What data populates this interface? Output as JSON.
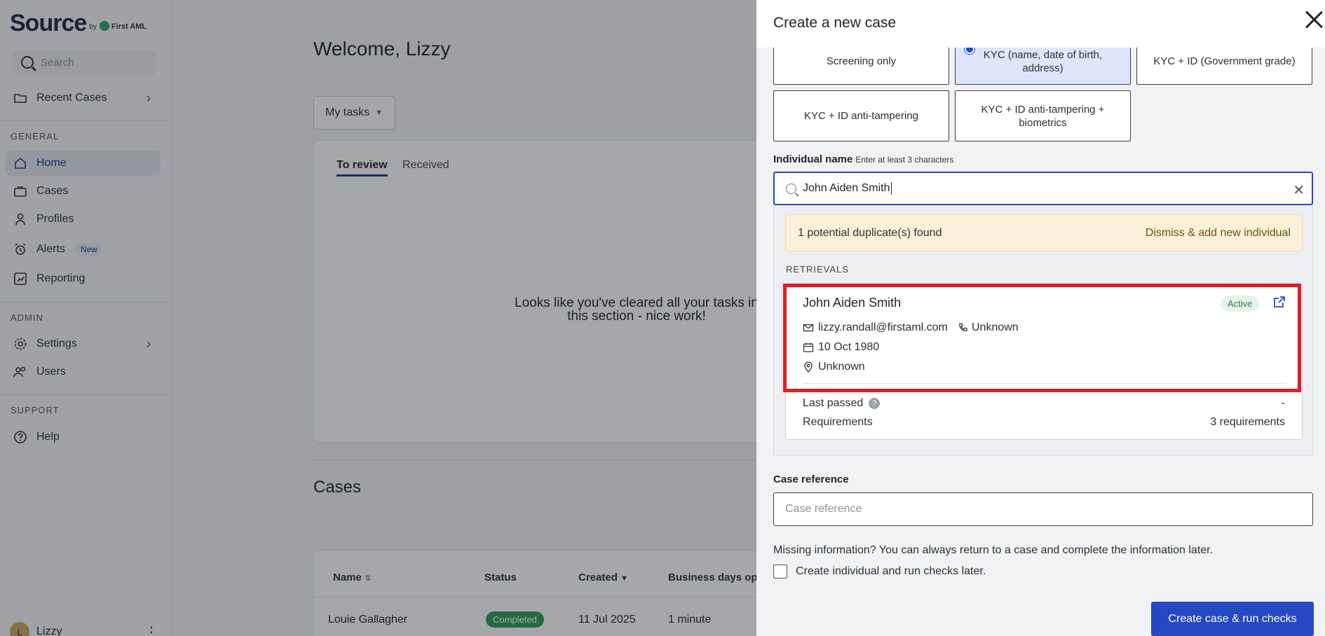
{
  "brand": {
    "name": "Source",
    "by": "by",
    "partner": "First AML"
  },
  "sidebar": {
    "search_placeholder": "Search",
    "recent_cases": "Recent Cases",
    "general_label": "GENERAL",
    "admin_label": "ADMIN",
    "support_label": "SUPPORT",
    "items": {
      "home": "Home",
      "cases": "Cases",
      "profiles": "Profiles",
      "alerts": "Alerts",
      "alerts_badge": "New",
      "reporting": "Reporting",
      "settings": "Settings",
      "users": "Users",
      "help": "Help"
    },
    "user": {
      "initial": "L",
      "name": "Lizzy"
    }
  },
  "main": {
    "welcome": "Welcome, Lizzy",
    "task_filter": "My tasks",
    "tabs": [
      "To review",
      "Received"
    ],
    "empty_message": "Looks like you've cleared all your tasks in this section - nice work!",
    "cases_title": "Cases",
    "table": {
      "headers": [
        "Name",
        "Status",
        "Created",
        "Business days ope"
      ],
      "rows": [
        {
          "name": "Louie Gallagher",
          "status": "Completed",
          "created": "11 Jul 2025",
          "business_days": "1 minute"
        }
      ]
    }
  },
  "drawer": {
    "title": "Create a new case",
    "options": [
      {
        "label": "Screening only",
        "selected": false
      },
      {
        "label": "KYC (name, date of birth, address)",
        "selected": true
      },
      {
        "label": "KYC + ID (Government grade)",
        "selected": false
      },
      {
        "label": "KYC + ID anti-tampering",
        "selected": false
      },
      {
        "label": "KYC + ID anti-tampering + biometrics",
        "selected": false
      }
    ],
    "individual_label": "Individual name",
    "individual_hint": "Enter at least 3 characters",
    "individual_value": "John Aiden Smith",
    "duplicate": {
      "message": "1 potential duplicate(s) found",
      "dismiss": "Dismiss & add new individual",
      "retrievals_label": "RETRIEVALS",
      "record": {
        "name": "John Aiden Smith",
        "status": "Active",
        "email": "lizzy.randall@firstaml.com",
        "phone": "Unknown",
        "dob": "10 Oct 1980",
        "address": "Unknown",
        "last_passed_label": "Last passed",
        "last_passed_value": "-",
        "requirements_label": "Requirements",
        "requirements_value": "3 requirements"
      }
    },
    "case_reference_label": "Case reference",
    "case_reference_placeholder": "Case reference",
    "missing_info": "Missing information? You can always return to a case and complete the information later.",
    "checkbox_label": "Create individual and run checks later.",
    "submit_label": "Create case & run checks"
  },
  "colors": {
    "primary": "#2548c4",
    "highlight": "#e31b23",
    "warning_bg": "#fbf1d8",
    "success": "#2f9b5b"
  }
}
